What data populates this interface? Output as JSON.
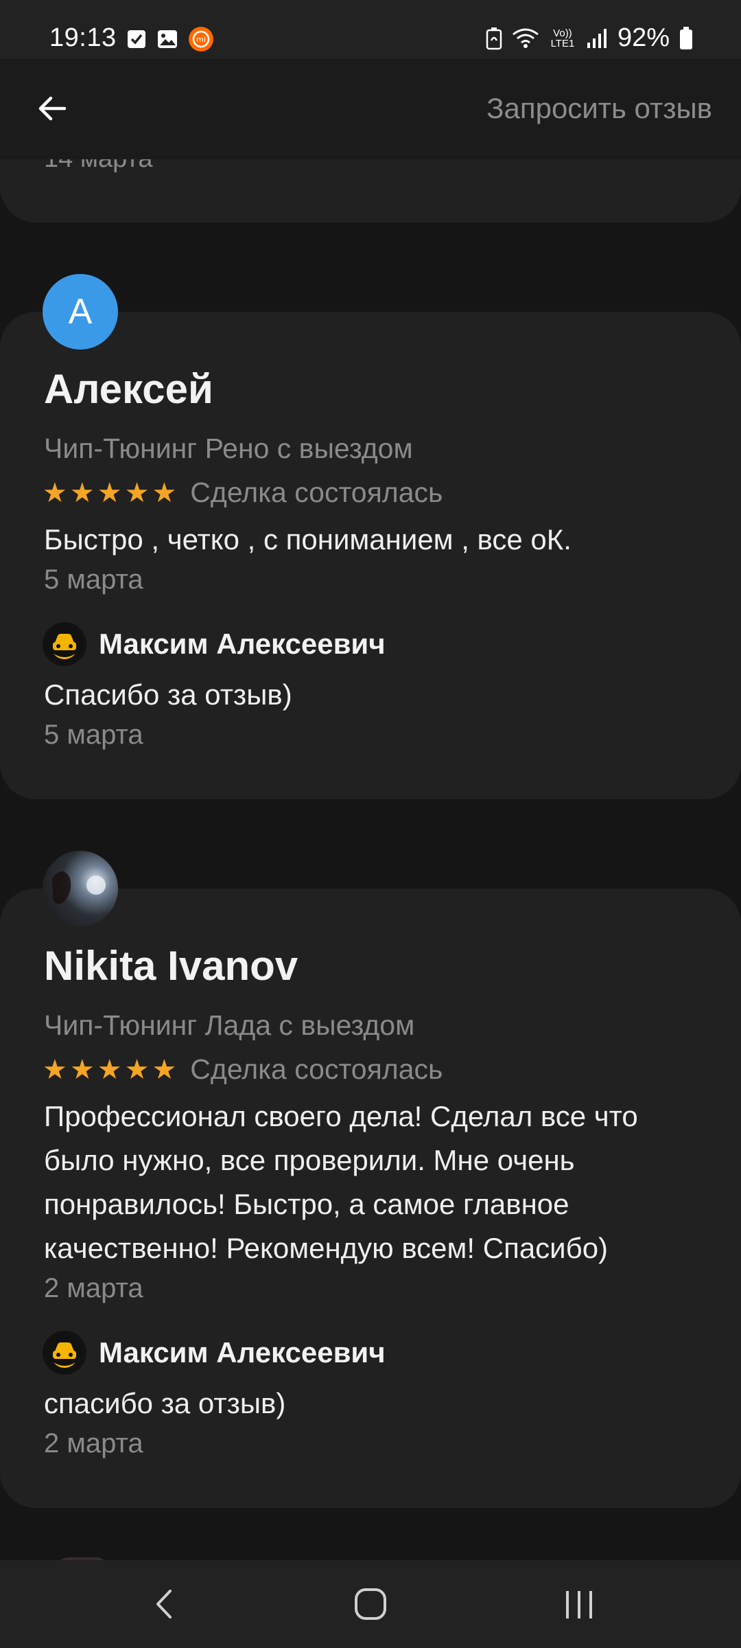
{
  "status_bar": {
    "time": "19:13",
    "battery": "92%",
    "network_label": "Vo)) LTE1"
  },
  "app_bar": {
    "request_review": "Запросить отзыв"
  },
  "previous_review": {
    "date": "14 марта"
  },
  "reviews": [
    {
      "avatar_letter": "А",
      "author": "Алексей",
      "service": "Чип-Тюнинг Рено с выездом",
      "stars": 5,
      "deal_status": "Сделка состоялась",
      "text": "Быстро , четко , с пониманием , все оК.",
      "date": "5 марта",
      "reply": {
        "author": "Максим Алексеевич",
        "text": "Спасибо за отзыв)",
        "date": "5 марта"
      }
    },
    {
      "author": "Nikita Ivanov",
      "service": "Чип-Тюнинг Лада с выездом",
      "stars": 5,
      "deal_status": "Сделка состоялась",
      "text": "Профессионал своего дела! Сделал все что было нужно, все проверили. Мне очень понравилось! Быстро, а самое главное качественно! Рекомендую всем! Спасибо)",
      "date": "2 марта",
      "reply": {
        "author": "Максим Алексеевич",
        "text": "спасибо за отзыв)",
        "date": "2 марта"
      }
    }
  ],
  "colors": {
    "background": "#151515",
    "card": "#212121",
    "star": "#f5a524",
    "avatar_blue": "#3b9ae8",
    "muted_text": "#8a8a8a"
  }
}
